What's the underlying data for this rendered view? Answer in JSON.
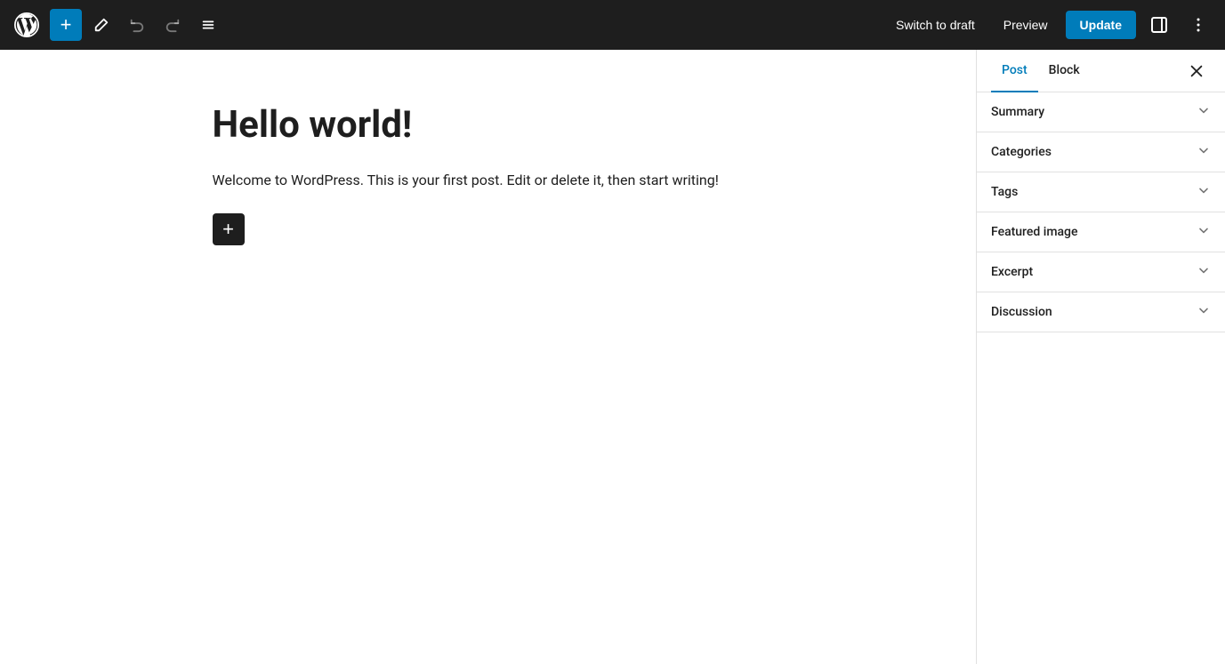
{
  "toolbar": {
    "add_label": "+",
    "switch_to_draft_label": "Switch to draft",
    "preview_label": "Preview",
    "update_label": "Update"
  },
  "editor": {
    "post_title": "Hello world!",
    "post_content": "Welcome to WordPress. This is your first post. Edit or delete it, then start writing!",
    "add_block_label": "+"
  },
  "sidebar": {
    "tab_post_label": "Post",
    "tab_block_label": "Block",
    "sections": [
      {
        "id": "summary",
        "label": "Summary"
      },
      {
        "id": "categories",
        "label": "Categories"
      },
      {
        "id": "tags",
        "label": "Tags"
      },
      {
        "id": "featured-image",
        "label": "Featured image"
      },
      {
        "id": "excerpt",
        "label": "Excerpt"
      },
      {
        "id": "discussion",
        "label": "Discussion"
      }
    ]
  }
}
